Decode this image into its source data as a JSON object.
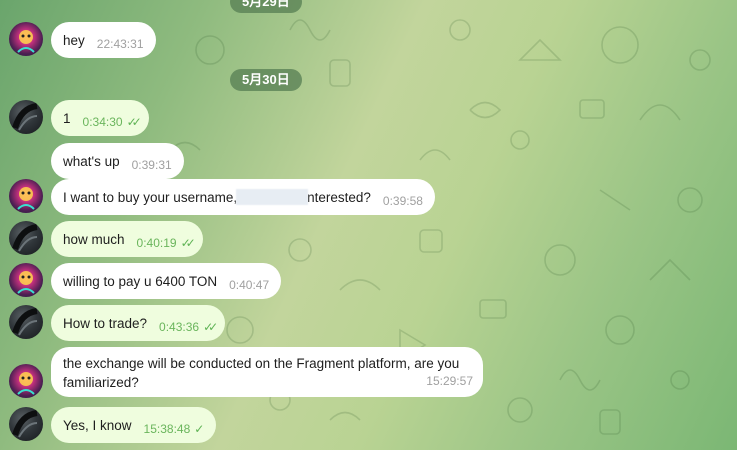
{
  "dates": {
    "top_partial": "5月29日",
    "second": "5月30日"
  },
  "colors": {
    "incoming_bubble": "#ffffff",
    "outgoing_bubble": "#effdde",
    "outgoing_time": "#6ab55c",
    "incoming_time": "#a0a0a0",
    "check_color": "#5fb355",
    "date_pill": "#58805a"
  },
  "messages": [
    {
      "sender": "other",
      "text": "hey",
      "time": "22:43:31"
    },
    {
      "sender": "me",
      "text": "1",
      "time": "0:34:30",
      "status": "read"
    },
    {
      "sender": "me",
      "text": "what's up",
      "time": "0:39:31"
    },
    {
      "sender": "other",
      "text_before": "I want to buy your username, ",
      "text_after": "nterested?",
      "time": "0:39:58"
    },
    {
      "sender": "me",
      "text": "how much",
      "time": "0:40:19",
      "status": "read"
    },
    {
      "sender": "other",
      "text": "willing to pay u 6400 TON",
      "time": "0:40:47"
    },
    {
      "sender": "me",
      "text": "How to trade?",
      "time": "0:43:36",
      "status": "read"
    },
    {
      "sender": "other",
      "line1": "the exchange will be conducted on the Fragment platform, are you",
      "line2": "familiarized?",
      "time": "15:29:57"
    },
    {
      "sender": "me",
      "text": "Yes, I know",
      "time": "15:38:48",
      "status": "sent"
    }
  ],
  "icons": {
    "read_check": "double-check-icon",
    "sent_check": "single-check-icon"
  }
}
